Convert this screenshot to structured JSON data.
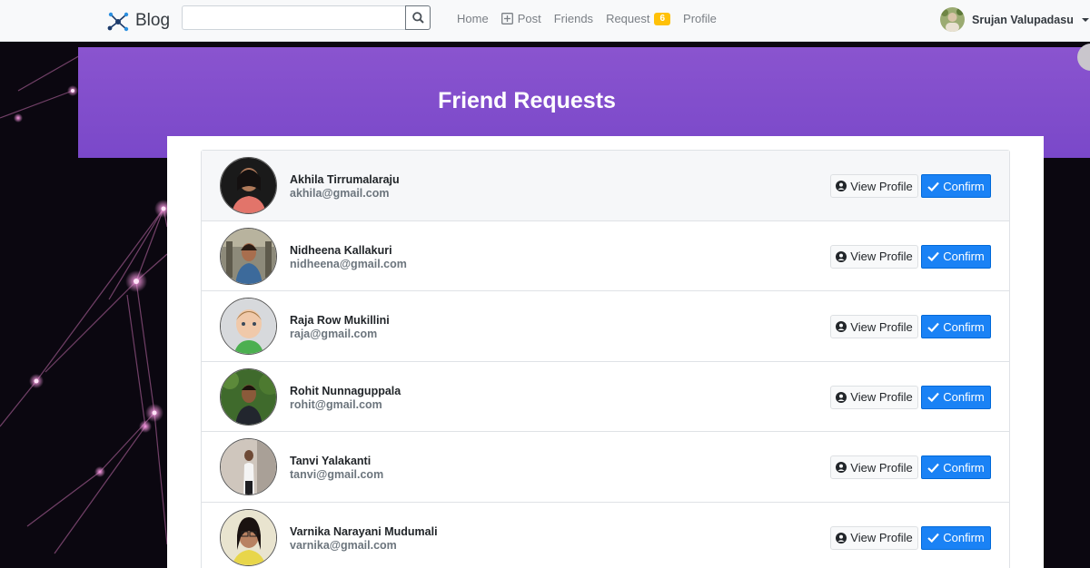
{
  "navbar": {
    "brand": "Blog",
    "search": {
      "value": "",
      "placeholder": ""
    },
    "links": [
      {
        "label": "Home"
      },
      {
        "label": "Post"
      },
      {
        "label": "Friends"
      },
      {
        "label": "Request",
        "badge": "6"
      },
      {
        "label": "Profile"
      }
    ],
    "user": {
      "name": "Srujan Valupadasu"
    }
  },
  "page": {
    "title": "Friend Requests"
  },
  "requests": [
    {
      "name": "Akhila Tirrumalaraju",
      "email": "akhila@gmail.com",
      "view_label": "View Profile",
      "confirm_label": "Confirm"
    },
    {
      "name": "Nidheena Kallakuri",
      "email": "nidheena@gmail.com",
      "view_label": "View Profile",
      "confirm_label": "Confirm"
    },
    {
      "name": "Raja Row Mukillini",
      "email": "raja@gmail.com",
      "view_label": "View Profile",
      "confirm_label": "Confirm"
    },
    {
      "name": "Rohit Nunnaguppala",
      "email": "rohit@gmail.com",
      "view_label": "View Profile",
      "confirm_label": "Confirm"
    },
    {
      "name": "Tanvi Yalakanti",
      "email": "tanvi@gmail.com",
      "view_label": "View Profile",
      "confirm_label": "Confirm"
    },
    {
      "name": "Varnika Narayani Mudumali",
      "email": "varnika@gmail.com",
      "view_label": "View Profile",
      "confirm_label": "Confirm"
    }
  ],
  "colors": {
    "hero": "#7a48c9",
    "confirm": "#1a82f5",
    "badge": "#ffc107"
  }
}
